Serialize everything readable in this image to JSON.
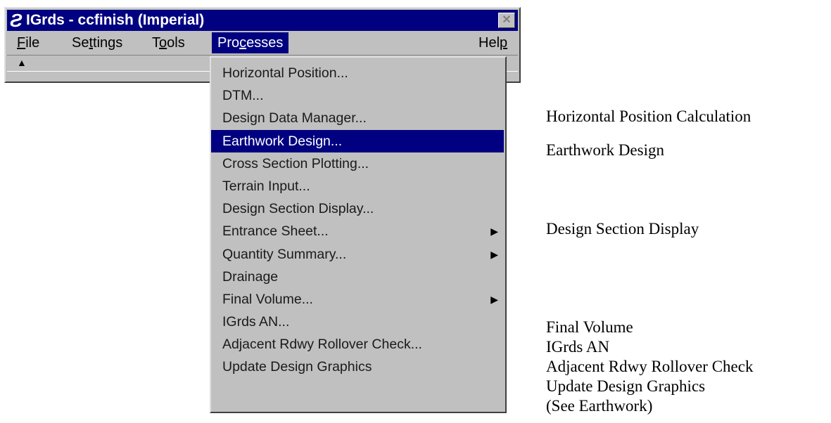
{
  "window": {
    "title": "IGrds - ccfinish (Imperial)",
    "logo_glyph": "Ƨ",
    "close_glyph": "✕"
  },
  "menubar": {
    "file": {
      "label_underline": "F",
      "label_rest": "ile"
    },
    "settings": {
      "label_pre": "Se",
      "label_underline": "t",
      "label_rest": "tings"
    },
    "tools": {
      "label_pre": "T",
      "label_underline": "o",
      "label_rest": "ols"
    },
    "processes": {
      "label_pre": "Pro",
      "label_underline": "c",
      "label_rest": "esses"
    },
    "help": {
      "label_pre": "Hel",
      "label_underline": "p",
      "label_rest": ""
    }
  },
  "toolbar": {
    "arrow_glyph": "▲"
  },
  "dropdown": {
    "items": [
      {
        "label": "Horizontal Position..."
      },
      {
        "label": "DTM..."
      },
      {
        "label": "Design Data Manager..."
      },
      {
        "label": "Earthwork Design...",
        "selected": true
      },
      {
        "label": "Cross Section Plotting..."
      },
      {
        "label": "Terrain Input..."
      },
      {
        "label": "Design Section Display..."
      },
      {
        "label": "Entrance Sheet...",
        "submenu": "▶"
      },
      {
        "label": "Quantity Summary...",
        "submenu": "▶"
      },
      {
        "label": "Drainage"
      },
      {
        "label": "Final Volume...",
        "submenu": "▶"
      },
      {
        "label": "IGrds AN..."
      },
      {
        "label": "Adjacent Rdwy Rollover Check..."
      },
      {
        "label": "Update Design Graphics"
      }
    ]
  },
  "annotations": {
    "horizontal_position": "Horizontal Position Calculation",
    "earthwork": "Earthwork Design",
    "design_section": "Design Section Display",
    "final_volume": "Final Volume",
    "igrds_an": "IGrds AN",
    "adjacent": "Adjacent Rdwy Rollover Check",
    "update_graphics": "Update Design Graphics",
    "see_earthwork": "(See Earthwork)"
  },
  "colors": {
    "titlebar": "#000080",
    "face": "#c0c0c0",
    "highlight": "#000080"
  }
}
